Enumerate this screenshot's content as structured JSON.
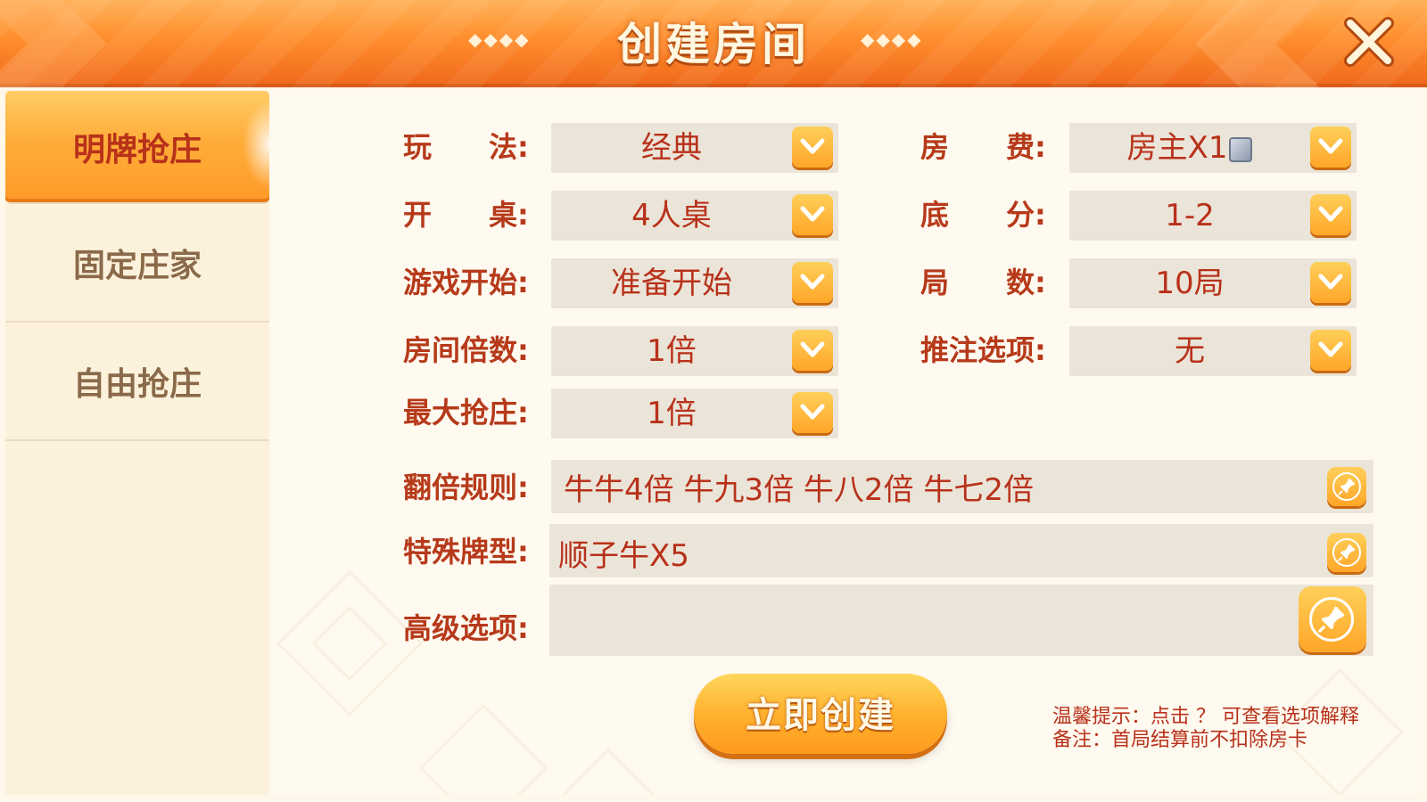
{
  "header": {
    "title": "创建房间",
    "deco_left": "◆◆◆◆",
    "deco_right": "◆◆◆◆"
  },
  "sidebar": {
    "tabs": [
      {
        "label": "明牌抢庄",
        "active": true
      },
      {
        "label": "固定庄家",
        "active": false
      },
      {
        "label": "自由抢庄",
        "active": false
      }
    ]
  },
  "form": {
    "play_mode": {
      "label": "玩　　法:",
      "value": "经典"
    },
    "room_fee": {
      "label": "房　　费:",
      "value": "房主X1"
    },
    "table": {
      "label": "开　　桌:",
      "value": "4人桌"
    },
    "base_score": {
      "label": "底　　分:",
      "value": "1-2"
    },
    "game_start": {
      "label": "游戏开始:",
      "value": "准备开始"
    },
    "rounds": {
      "label": "局　　数:",
      "value": "10局"
    },
    "room_multiplier": {
      "label": "房间倍数:",
      "value": "1倍"
    },
    "push_bet": {
      "label": "推注选项:",
      "value": "无"
    },
    "max_grab": {
      "label": "最大抢庄:",
      "value": "1倍"
    },
    "double_rules": {
      "label": "翻倍规则:",
      "value": "牛牛4倍 牛九3倍 牛八2倍 牛七2倍"
    },
    "special_cards": {
      "label": "特殊牌型:",
      "value": "顺子牛X5"
    },
    "advanced": {
      "label": "高级选项:",
      "value": ""
    }
  },
  "actions": {
    "create_label": "立即创建"
  },
  "tips": {
    "line1": "温馨提示：点击 ？ 可查看选项解释",
    "line2": "备注：首局结算前不扣除房卡"
  },
  "colors": {
    "accent_orange": "#ff9a28",
    "text_red": "#b8311a",
    "field_bg": "#ebe4d8"
  }
}
